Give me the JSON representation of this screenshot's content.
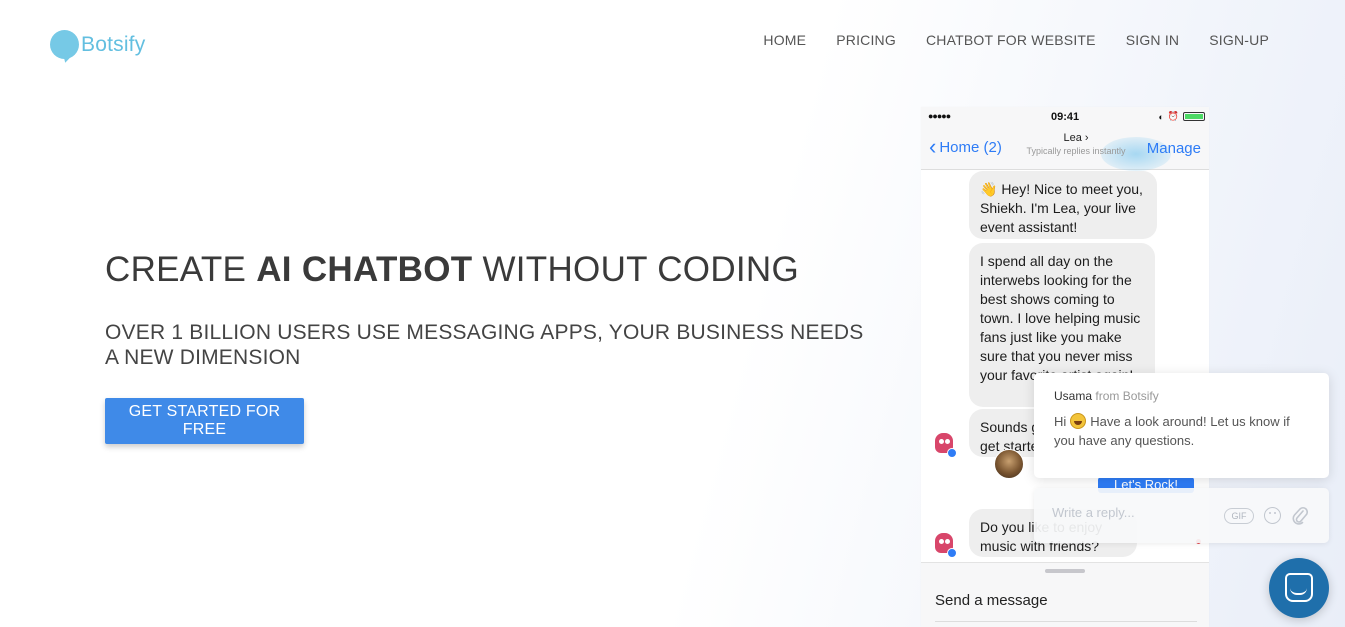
{
  "brand": {
    "name": "Botsify",
    "color": "#63bfe0"
  },
  "nav": {
    "items": [
      "HOME",
      "PRICING",
      "CHATBOT FOR WEBSITE",
      "SIGN IN",
      "SIGN-UP"
    ]
  },
  "hero": {
    "title_pre": "CREATE ",
    "title_bold": "AI CHATBOT",
    "title_post": " WITHOUT CODING",
    "subtitle": "OVER 1 BILLION USERS USE MESSAGING APPS, YOUR BUSINESS NEEDS A NEW DIMENSION",
    "cta_label": "GET STARTED FOR FREE",
    "cta_color": "#3f8ae8"
  },
  "phone": {
    "status": {
      "signal": "●●●●● ",
      "time": "09:41"
    },
    "navbar": {
      "back_label": "Home (2)",
      "contact_name": "Lea",
      "contact_status": "Typically replies instantly",
      "right_label": "Manage"
    },
    "messages": [
      "👋 Hey! Nice to meet you, Shiekh. I'm Lea, your live event assistant!",
      "I spend all day on the interwebs looking for the best shows coming to town. I love helping music fans just like you make sure that you never miss your favorite artist again!",
      "Sounds good? Let's get started!",
      "Do you like to enjoy music with friends?"
    ],
    "quick_reply": "Let's Rock!",
    "composer_placeholder": "Send a message"
  },
  "chat_widget": {
    "agent_name": "Usama",
    "agent_org": "from Botsify",
    "greeting_pre": "Hi",
    "greeting_post": "Have a look around! Let us know if you have any questions.",
    "reply_placeholder": "Write a reply...",
    "gif_label": "GIF",
    "launcher_color": "#1f6fab"
  }
}
